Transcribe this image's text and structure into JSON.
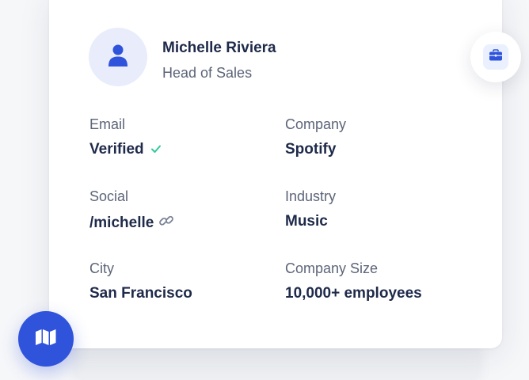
{
  "profile": {
    "name": "Michelle Riviera",
    "title": "Head of Sales"
  },
  "fields": {
    "email": {
      "label": "Email",
      "value": "Verified"
    },
    "company": {
      "label": "Company",
      "value": "Spotify"
    },
    "social": {
      "label": "Social",
      "value": "/michelle"
    },
    "industry": {
      "label": "Industry",
      "value": "Music"
    },
    "city": {
      "label": "City",
      "value": "San Francisco"
    },
    "company_size": {
      "label": "Company Size",
      "value": "10,000+ employees"
    }
  },
  "icons": {
    "avatar": "user-icon",
    "verified": "check-icon",
    "social_link": "link-icon",
    "badge": "briefcase-icon",
    "map": "map-icon"
  },
  "colors": {
    "accent": "#2f53db",
    "verified_check": "#2fc99a",
    "avatar_bg": "#e8ecfb",
    "text_primary": "#1e2a4a",
    "text_secondary": "#5c6478"
  }
}
